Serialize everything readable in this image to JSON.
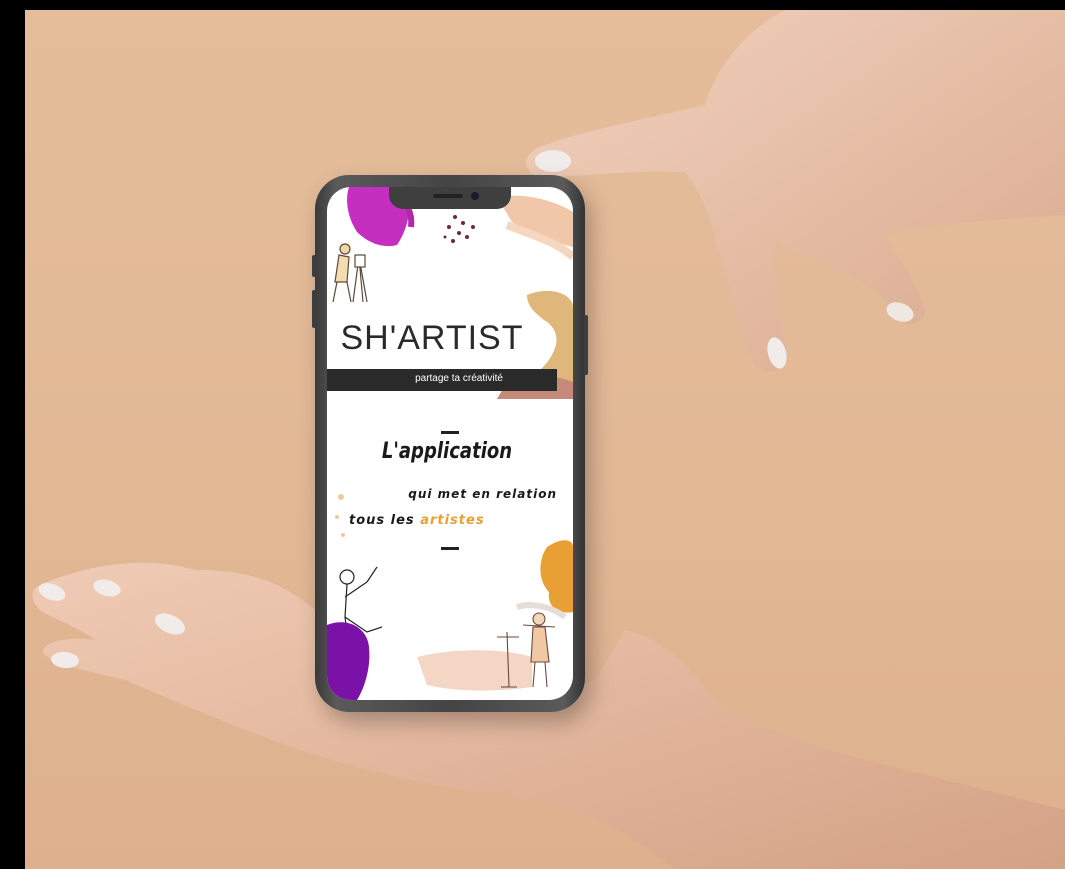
{
  "app": {
    "logo_text": "SH'ARTIST",
    "tagline": "partage ta créativité"
  },
  "headline": {
    "line1": "L'application",
    "line2": "qui met en relation",
    "line3_prefix": "tous les ",
    "line3_accent": "artistes"
  },
  "colors": {
    "background": "#e2b895",
    "accent_orange": "#e8a035",
    "accent_magenta": "#c52fbf",
    "accent_purple": "#7a12a8",
    "phone_body": "#444444"
  }
}
